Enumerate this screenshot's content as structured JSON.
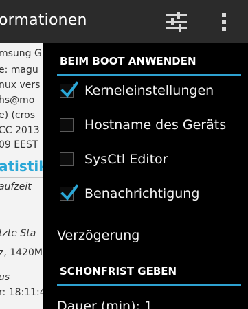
{
  "actionbar": {
    "title": "ormationen",
    "sliders_icon": "sliders-icon",
    "overflow_icon": "overflow-menu-icon"
  },
  "background": {
    "lines": [
      "msung G",
      "e: magu",
      "nux vers",
      "hs@mo",
      "e) (cros",
      "CC 2013",
      "09 EEST"
    ],
    "section_title": "atistik",
    "label_uptime": "aufzeit",
    "label_last_state": "tzte Sta",
    "value_freq": "z, 1420M",
    "label_status": "us",
    "value_time": "r: 18:11:4"
  },
  "dropdown": {
    "header_boot": "BEIM BOOT ANWENDEN",
    "items": [
      {
        "label": "Kerneleinstellungen",
        "checked": true
      },
      {
        "label": "Hostname des Geräts",
        "checked": false
      },
      {
        "label": "SysCtl Editor",
        "checked": false
      },
      {
        "label": "Benachrichtigung",
        "checked": true
      }
    ],
    "delay_label": "Verzögerung",
    "header_grace": "SCHONFRIST GEBEN",
    "duration_label": "Dauer (min): 1"
  },
  "colors": {
    "accent": "#2ea1d0",
    "actionbar_bg": "#2b2b2b",
    "menu_bg": "#000000",
    "check_blue": "#2aa7d7"
  }
}
